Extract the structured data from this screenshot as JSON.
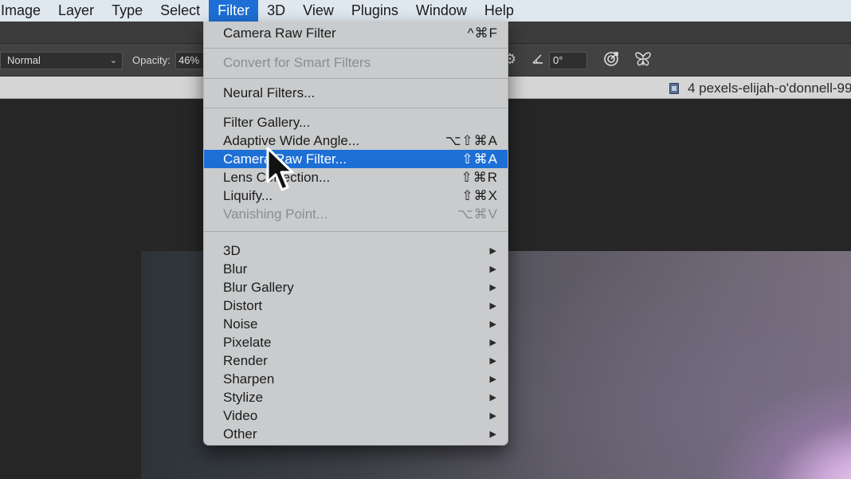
{
  "menubar": {
    "items": [
      "Image",
      "Layer",
      "Type",
      "Select",
      "Filter",
      "3D",
      "View",
      "Plugins",
      "Window",
      "Help"
    ],
    "active": "Filter"
  },
  "options_bar": {
    "blend_mode": "Normal",
    "opacity_label": "Opacity:",
    "opacity_value": "46%",
    "angle_value": "0°",
    "icons": [
      "gear-icon",
      "angle-icon",
      "target-icon",
      "butterfly-icon"
    ]
  },
  "document_tab": {
    "title": "4 pexels-elijah-o'donnell-99"
  },
  "filter_menu": {
    "last_filter": {
      "label": "Camera Raw Filter",
      "shortcut": "^⌘F"
    },
    "convert_smart": {
      "label": "Convert for Smart Filters"
    },
    "neural": {
      "label": "Neural Filters..."
    },
    "gallery_group": [
      {
        "label": "Filter Gallery...",
        "shortcut": ""
      },
      {
        "label": "Adaptive Wide Angle...",
        "shortcut": "⌥⇧⌘A"
      },
      {
        "label": "Camera Raw Filter...",
        "shortcut": "⇧⌘A"
      },
      {
        "label": "Lens Correction...",
        "shortcut": "⇧⌘R"
      },
      {
        "label": "Liquify...",
        "shortcut": "⇧⌘X"
      },
      {
        "label": "Vanishing Point...",
        "shortcut": "⌥⌘V"
      }
    ],
    "submenus": [
      "3D",
      "Blur",
      "Blur Gallery",
      "Distort",
      "Noise",
      "Pixelate",
      "Render",
      "Sharpen",
      "Stylize",
      "Video",
      "Other"
    ],
    "highlighted": "Camera Raw Filter...",
    "disabled": [
      "Convert for Smart Filters",
      "Vanishing Point..."
    ]
  },
  "colors": {
    "highlight": "#1d6fd6",
    "menu_bg": "#c9cbcd",
    "menubar_bg": "#dfe8ef"
  }
}
